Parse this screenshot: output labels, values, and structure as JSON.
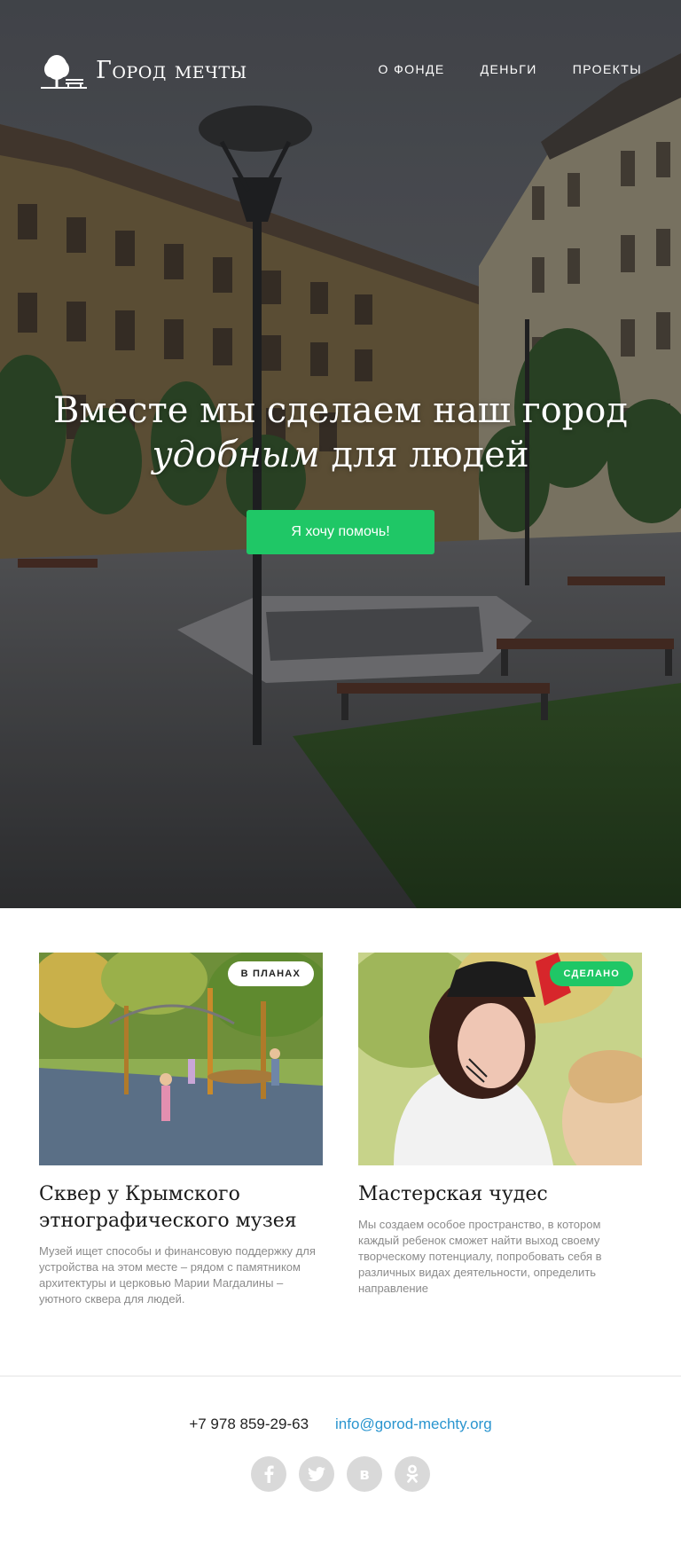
{
  "brand": {
    "name": "Город мечты"
  },
  "nav": {
    "items": [
      {
        "label": "О ФОНДЕ"
      },
      {
        "label": "ДЕНЬГИ"
      },
      {
        "label": "ПРОЕКТЫ"
      }
    ]
  },
  "hero": {
    "headline_line1": "Вместе мы сделаем наш город",
    "headline_em": "удобным",
    "headline_rest": " для людей",
    "cta_label": "Я хочу помочь!"
  },
  "projects": [
    {
      "status": "В ПЛАНАХ",
      "title": "Сквер у Крымского этнографического музея",
      "description": "Музей ищет способы и финансовую поддержку для устройства на этом месте – рядом с памятником архитектуры и церковью Марии Магдалины – уютного сквера для людей."
    },
    {
      "status": "СДЕЛАНО",
      "title": "Мастерская чудес",
      "description": "Мы создаем особое пространство, в котором каждый ребенок сможет найти выход своему творческому потенциалу, попробовать себя в различных видах деятельности, определить направление"
    }
  ],
  "footer": {
    "phone": "+7 978 859-29-63",
    "email": "info@gorod-mechty.org",
    "socials": [
      {
        "icon": "facebook-icon",
        "glyph": "f"
      },
      {
        "icon": "twitter-icon",
        "glyph": "t"
      },
      {
        "icon": "vk-icon",
        "glyph": "в"
      },
      {
        "icon": "odnoklassniki-icon",
        "glyph": "ok"
      }
    ]
  },
  "colors": {
    "accent": "#1fc766",
    "link": "#2a95cf",
    "muted_text": "#8b8b8b",
    "social_bg": "#d9d9d9"
  }
}
